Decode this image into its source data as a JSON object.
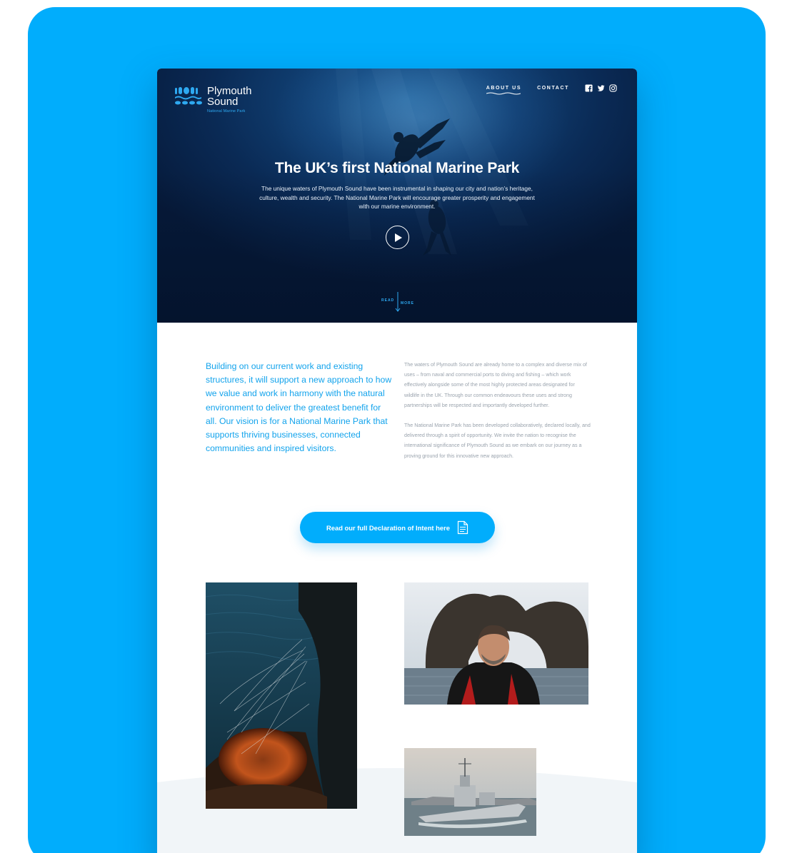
{
  "brand": {
    "logo_line1": "Plymouth",
    "logo_line2": "Sound",
    "logo_sub": "National Marine Park",
    "accent": "#01adfc",
    "accent_text": "#12a3ec",
    "hero_navy": "#0a2a55"
  },
  "nav": {
    "items": [
      {
        "label": "ABOUT US"
      },
      {
        "label": "CONTACT"
      }
    ],
    "social": [
      "facebook-icon",
      "twitter-icon",
      "instagram-icon"
    ]
  },
  "hero": {
    "title": "The UK’s first National Marine Park",
    "description": "The unique waters of Plymouth Sound have been instrumental in shaping our city and nation’s heritage, culture, wealth and security. The National Marine Park will encourage greater prosperity and engagement with our marine environment.",
    "play_icon": "play-icon",
    "read_more_left": "READ",
    "read_more_right": "MORE"
  },
  "intro": {
    "lead": "Building on our current work and existing structures, it will support a new approach to how we value and work in harmony with the natural environment to deliver the greatest benefit for all.  Our vision is for a National Marine Park that supports thriving businesses, connected communities and inspired visitors.",
    "paragraphs": [
      "The waters of Plymouth Sound are already home to a complex and diverse mix of uses – from naval and commercial ports to diving and fishing – which work effectively alongside some of the most highly protected areas designated for wildlife in the UK.  Through our common endeavours these uses and strong partnerships will be respected and importantly developed further.",
      "The National Marine Park has been developed collaboratively, declared locally, and delivered through a spirit of opportunity. We invite the nation to recognise the international significance of Plymouth Sound as we embark on our journey as a proving ground for this innovative new approach."
    ]
  },
  "cta": {
    "label": "Read our full Declaration of Intent here",
    "icon": "document-icon"
  }
}
